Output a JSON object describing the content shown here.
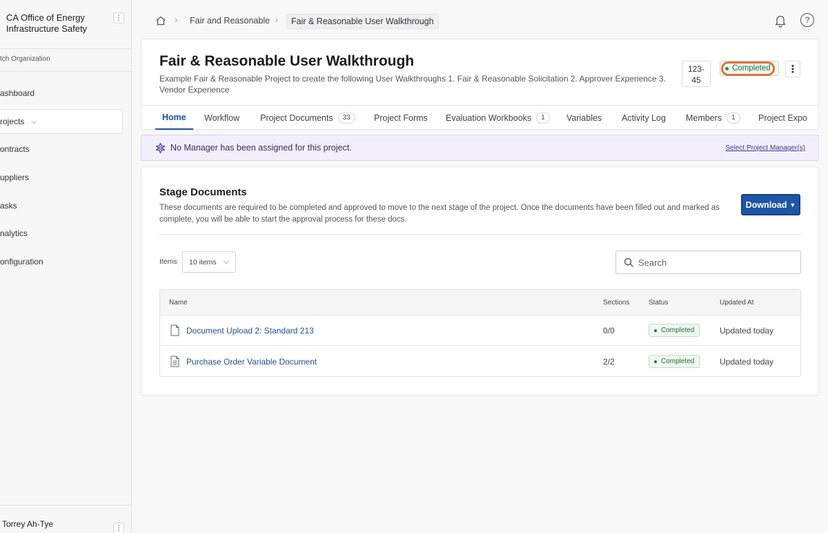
{
  "sidebar": {
    "org_name": "CA Office of Energy Infrastructure Safety",
    "switch_org": "tch Organization",
    "items": [
      {
        "label": "ashboard"
      },
      {
        "label": "rojects"
      },
      {
        "label": "ontracts"
      },
      {
        "label": "uppliers"
      },
      {
        "label": "asks"
      },
      {
        "label": "nalytics"
      },
      {
        "label": "onfiguration"
      }
    ],
    "user_name": "Torrey Ah-Tye"
  },
  "breadcrumb": {
    "items": [
      "Fair and Reasonable",
      "Fair & Reasonable User Walkthrough"
    ]
  },
  "project": {
    "title": "Fair & Reasonable User Walkthrough",
    "description": "Example Fair & Reasonable Project to create the following User Walkthroughs 1. Fair & Reasonable Solicitation 2. Approver Experience 3. Vendor Experience",
    "id": "123-\n45",
    "status": "Completed"
  },
  "tabs": [
    {
      "label": "Home",
      "count": null
    },
    {
      "label": "Workflow",
      "count": null
    },
    {
      "label": "Project Documents",
      "count": "33"
    },
    {
      "label": "Project Forms",
      "count": null
    },
    {
      "label": "Evaluation Workbooks",
      "count": "1"
    },
    {
      "label": "Variables",
      "count": null
    },
    {
      "label": "Activity Log",
      "count": null
    },
    {
      "label": "Members",
      "count": "1"
    },
    {
      "label": "Project Expo",
      "count": null
    }
  ],
  "banner": {
    "text": "No Manager has been assigned for this project.",
    "link": "Select Project Manager(s)"
  },
  "stage_docs": {
    "title": "Stage Documents",
    "description": "These documents are required to be completed and approved to move to the next stage of the project. Once the documents have been filled out and marked as complete, you will be able to start the approval process for these docs.",
    "download_label": "Download",
    "items_label": "Items",
    "items_value": "10 items",
    "search_placeholder": "Search",
    "columns": [
      "Name",
      "Sections",
      "Status",
      "Updated At"
    ],
    "rows": [
      {
        "name": "Document Upload 2: Standard 213",
        "sections": "0/0",
        "status": "Completed",
        "updated": "Updated today"
      },
      {
        "name": "Purchase Order Variable Document",
        "sections": "2/2",
        "status": "Completed",
        "updated": "Updated today"
      }
    ]
  },
  "colors": {
    "accent": "#1f55a7",
    "link": "#1e4f9b",
    "success_bg": "#eef8f0",
    "success_text": "#2d6b3b",
    "banner_bg": "#f3eefb",
    "highlight_ring": "#e0703a"
  },
  "icons": [
    "home-icon",
    "chevron-right-icon",
    "bell-icon",
    "help-icon",
    "kebab-icon",
    "sparkle-icon",
    "search-icon",
    "document-icon",
    "chevron-down-icon"
  ]
}
